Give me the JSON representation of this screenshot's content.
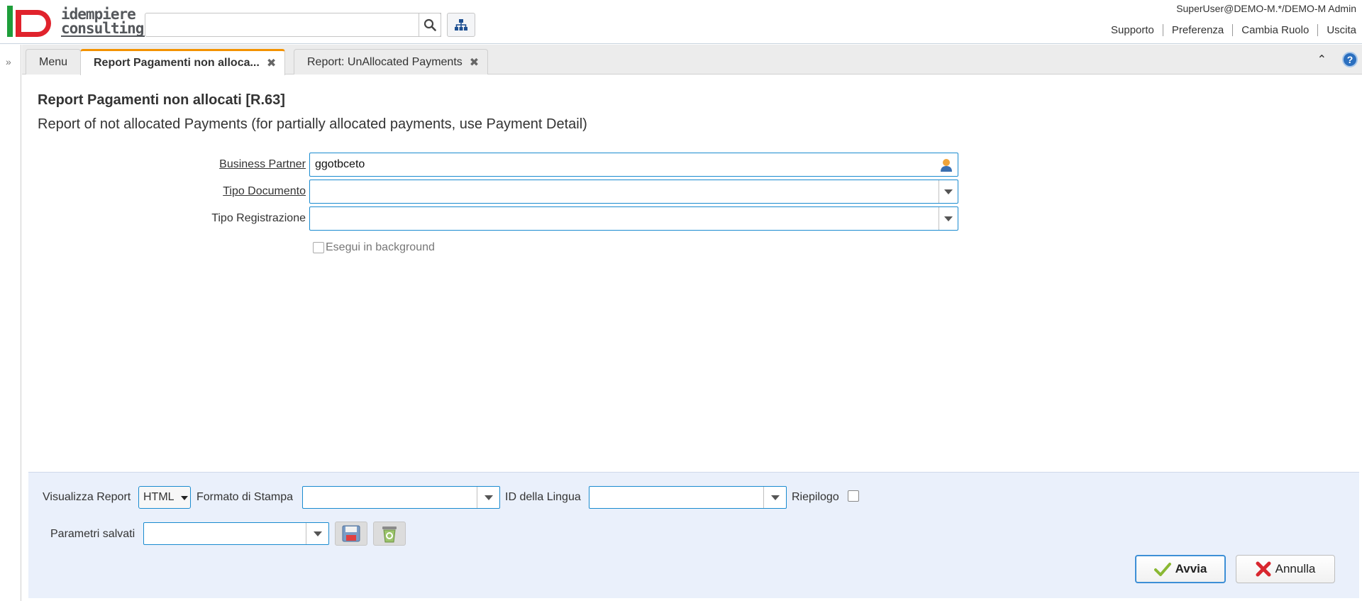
{
  "header": {
    "brand_line1": "idempiere",
    "brand_line2": "consulting",
    "search_value": "",
    "user_info": "SuperUser@DEMO-M.*/DEMO-M Admin",
    "links": [
      "Supporto",
      "Preferenza",
      "Cambia Ruolo",
      "Uscita"
    ]
  },
  "tabs": [
    {
      "label": "Menu",
      "active": false
    },
    {
      "label": "Report Pagamenti non alloca...",
      "active": true
    },
    {
      "label": "Report: UnAllocated Payments",
      "active": false
    }
  ],
  "process": {
    "title": "Report Pagamenti non allocati [R.63]",
    "description": "Report of not allocated Payments (for partially allocated payments, use Payment Detail)",
    "fields": {
      "business_partner": {
        "label": "Business Partner",
        "value": "ggotbceto"
      },
      "doc_type": {
        "label": "Tipo Documento",
        "value": ""
      },
      "posting_type": {
        "label": "Tipo Registrazione",
        "value": ""
      }
    },
    "background_label": "Esegui in background"
  },
  "bottom": {
    "view_report_label": "Visualizza Report",
    "view_report_value": "HTML",
    "print_format_label": "Formato di Stampa",
    "language_label": "ID della Lingua",
    "summary_label": "Riepilogo",
    "saved_params_label": "Parametri salvati",
    "run_label": "Avvia",
    "cancel_label": "Annulla"
  },
  "colors": {
    "accent_tab": "#f39200",
    "field_border": "#1a8bd0",
    "bottom_bg": "#eaf0fb"
  }
}
